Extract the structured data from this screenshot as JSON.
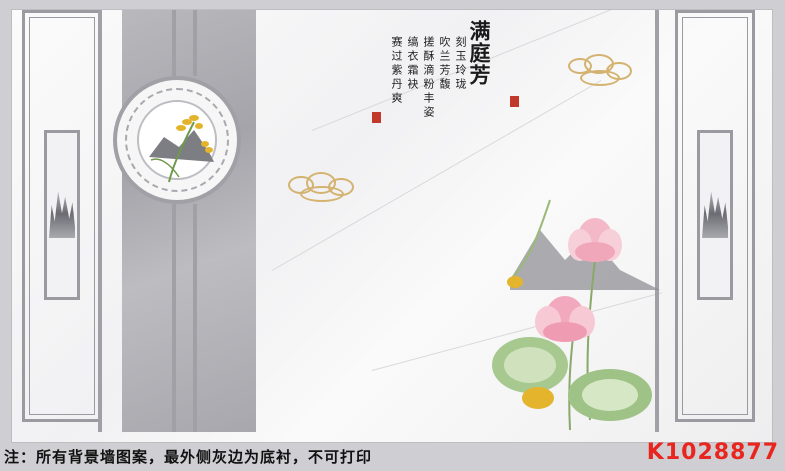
{
  "artwork": {
    "title": "满庭芳",
    "poem_columns": [
      "刻玉玲珑",
      "吹兰芳馥",
      "搓酥滴粉丰姿",
      "缟衣霜袂",
      "赛过紫丹爽"
    ],
    "notice": "注：所有背景墙图案，最外侧灰边为底衬，不可打印",
    "product_code": "K1028877"
  },
  "colors": {
    "background": "#cfcfd3",
    "frame": "#9a9aa0",
    "cloud_gold": "#d4b370",
    "seal_red": "#c0392b",
    "code_red": "#e8251f"
  }
}
